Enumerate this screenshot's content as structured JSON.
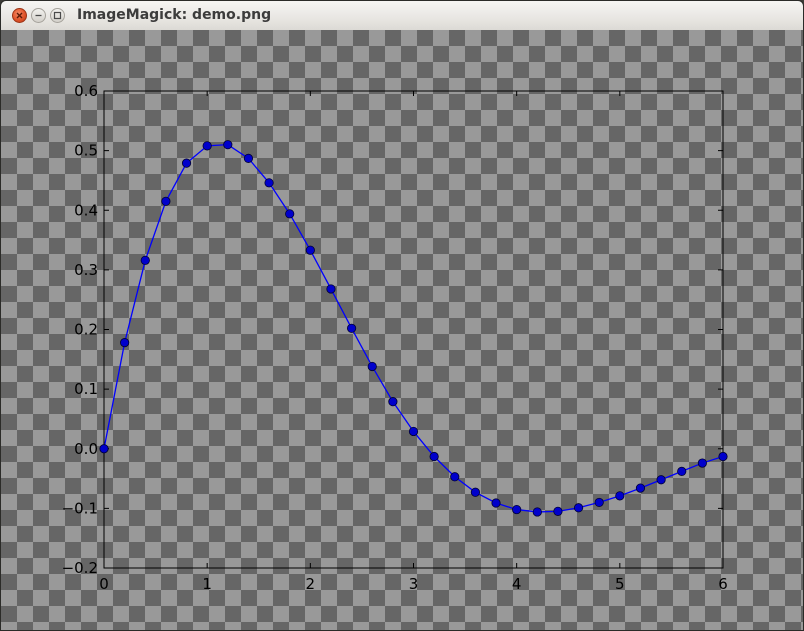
{
  "window": {
    "title": "ImageMagick: demo.png",
    "buttons": {
      "close": "close-icon",
      "minimize": "minimize-icon",
      "maximize": "maximize-icon"
    }
  },
  "chart_data": {
    "type": "line",
    "title": "",
    "xlabel": "",
    "ylabel": "",
    "xlim": [
      0,
      6
    ],
    "ylim": [
      -0.2,
      0.6
    ],
    "xticks": [
      0,
      1,
      2,
      3,
      4,
      5,
      6
    ],
    "xtick_labels": [
      "0",
      "1",
      "2",
      "3",
      "4",
      "5",
      "6"
    ],
    "yticks": [
      -0.2,
      -0.1,
      0.0,
      0.1,
      0.2,
      0.3,
      0.4,
      0.5,
      0.6
    ],
    "ytick_labels": [
      "−0.2",
      "−0.1",
      "0.0",
      "0.1",
      "0.2",
      "0.3",
      "0.4",
      "0.5",
      "0.6"
    ],
    "grid": false,
    "legend": "none",
    "marker": "circle",
    "series": [
      {
        "color": "#0000ff",
        "marker_color": "#0000cc",
        "x": [
          0.0,
          0.2,
          0.4,
          0.6,
          0.8,
          1.0,
          1.2,
          1.4,
          1.6,
          1.8,
          2.0,
          2.2,
          2.4,
          2.6,
          2.8,
          3.0,
          3.2,
          3.4,
          3.6,
          3.8,
          4.0,
          4.2,
          4.4,
          4.6,
          4.8,
          5.0,
          5.2,
          5.4,
          5.6,
          5.8,
          6.0
        ],
        "y": [
          0.0,
          0.178,
          0.316,
          0.415,
          0.479,
          0.508,
          0.51,
          0.487,
          0.446,
          0.394,
          0.333,
          0.268,
          0.202,
          0.138,
          0.079,
          0.029,
          -0.013,
          -0.047,
          -0.073,
          -0.091,
          -0.102,
          -0.106,
          -0.105,
          -0.099,
          -0.09,
          -0.079,
          -0.066,
          -0.052,
          -0.038,
          -0.024,
          -0.013
        ]
      }
    ]
  }
}
